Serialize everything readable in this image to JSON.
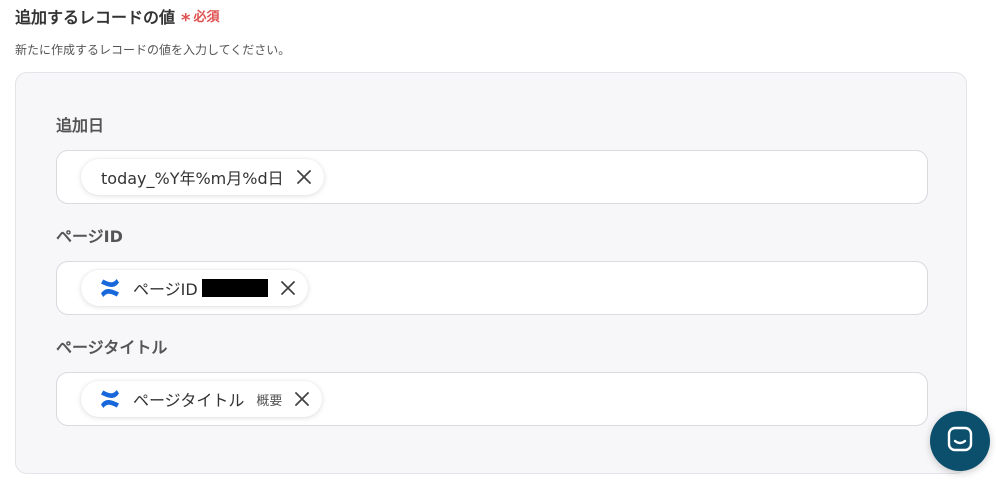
{
  "section": {
    "title": "追加するレコードの値",
    "required_mark": "*",
    "required_label": "必須",
    "description": "新たに作成するレコードの値を入力してください。"
  },
  "fields": [
    {
      "label": "追加日",
      "chip": {
        "text": "today_%Y年%m月%d日",
        "icon": null,
        "sub_label": ""
      }
    },
    {
      "label": "ページID",
      "chip": {
        "text": "ページID",
        "icon": "confluence-icon",
        "redacted": true,
        "sub_label": ""
      }
    },
    {
      "label": "ページタイトル",
      "chip": {
        "text": "ページタイトル",
        "icon": "confluence-icon",
        "sub_label": "概要"
      }
    }
  ],
  "colors": {
    "required": "#e05252",
    "panel_bg": "#f7f7f9",
    "confluence_blue": "#1868db",
    "chat_fab": "#0b4f6c"
  },
  "icons": {
    "remove": "close-icon",
    "chat": "chat-icon"
  }
}
